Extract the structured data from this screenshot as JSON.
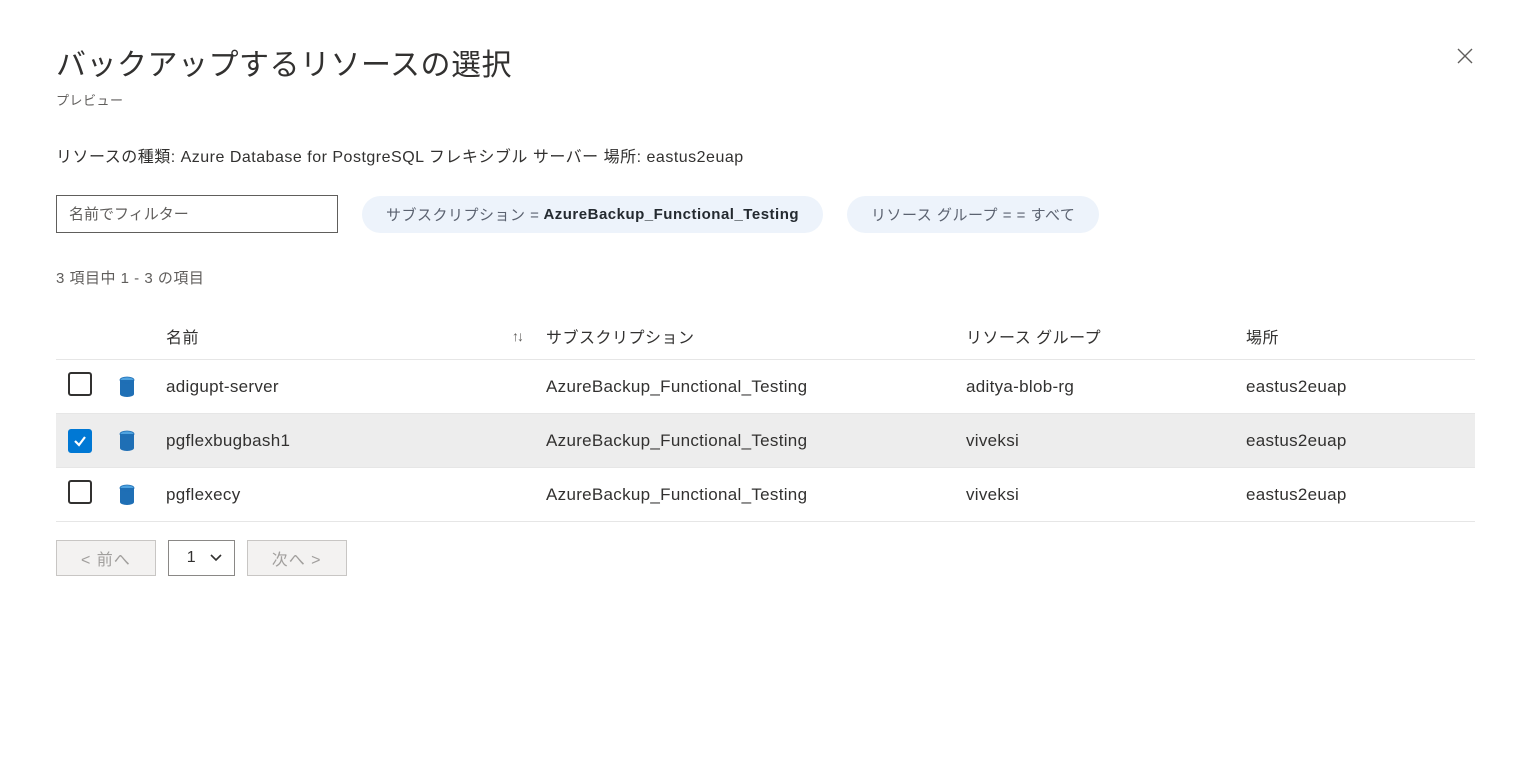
{
  "header": {
    "title": "バックアップするリソースの選択",
    "subtitle": "プレビュー"
  },
  "resource_type_line": "リソースの種類: Azure Database for PostgreSQL フレキシブル サーバー 場所: eastus2euap",
  "filters": {
    "name_placeholder": "名前でフィルター",
    "subscription_pill_label": "サブスクリプション = ",
    "subscription_pill_value": "AzureBackup_Functional_Testing",
    "rg_pill_text": "リソース グループ =  = すべて"
  },
  "count_text": "3 項目中 1 - 3 の項目",
  "columns": {
    "name": "名前",
    "subscription": "サブスクリプション",
    "resource_group": "リソース グループ",
    "location": "場所"
  },
  "rows": [
    {
      "name": "adigupt-server",
      "subscription": "AzureBackup_Functional_Testing",
      "rg": "aditya-blob-rg",
      "location": "eastus2euap",
      "selected": false
    },
    {
      "name": "pgflexbugbash1",
      "subscription": "AzureBackup_Functional_Testing",
      "rg": "viveksi",
      "location": "eastus2euap",
      "selected": true
    },
    {
      "name": "pgflexecy",
      "subscription": "AzureBackup_Functional_Testing",
      "rg": "viveksi",
      "location": "eastus2euap",
      "selected": false
    }
  ],
  "pagination": {
    "prev": "< 前へ",
    "next": "次へ >",
    "page": "1"
  }
}
